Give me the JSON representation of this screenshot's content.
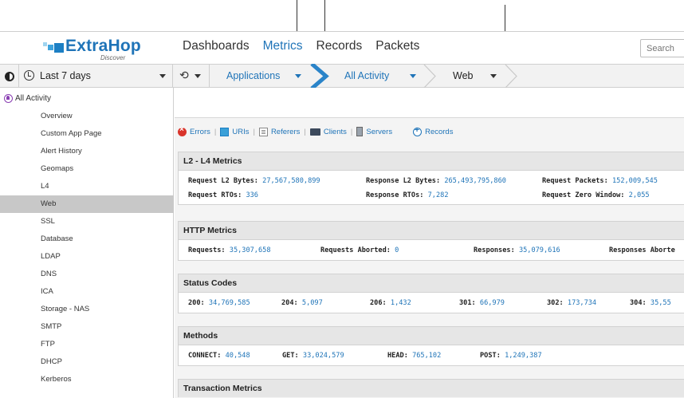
{
  "header": {
    "logo_text": "ExtraHop",
    "logo_sub": "Discover",
    "nav": [
      {
        "label": "Dashboards",
        "active": false
      },
      {
        "label": "Metrics",
        "active": true
      },
      {
        "label": "Records",
        "active": false
      },
      {
        "label": "Packets",
        "active": false
      }
    ],
    "search_placeholder": "Search"
  },
  "toolbar": {
    "time_range": "Last 7 days",
    "refresh_icon": "⟲",
    "breadcrumbs": [
      "Applications",
      "All Activity",
      "Web"
    ]
  },
  "sidebar": {
    "root": "All Activity",
    "items": [
      {
        "label": "Overview",
        "active": false
      },
      {
        "label": "Custom App Page",
        "active": false
      },
      {
        "label": "Alert History",
        "active": false
      },
      {
        "label": "Geomaps",
        "active": false
      },
      {
        "label": "L4",
        "active": false
      },
      {
        "label": "Web",
        "active": true
      },
      {
        "label": "SSL",
        "active": false
      },
      {
        "label": "Database",
        "active": false
      },
      {
        "label": "LDAP",
        "active": false
      },
      {
        "label": "DNS",
        "active": false
      },
      {
        "label": "ICA",
        "active": false
      },
      {
        "label": "Storage - NAS",
        "active": false
      },
      {
        "label": "SMTP",
        "active": false
      },
      {
        "label": "FTP",
        "active": false
      },
      {
        "label": "DHCP",
        "active": false
      },
      {
        "label": "Kerberos",
        "active": false
      }
    ]
  },
  "links": [
    {
      "label": "Errors",
      "icon": "error-icon"
    },
    {
      "label": "URIs",
      "icon": "uri-icon"
    },
    {
      "label": "Referers",
      "icon": "document-icon"
    },
    {
      "label": "Clients",
      "icon": "client-icon"
    },
    {
      "label": "Servers",
      "icon": "server-icon"
    },
    {
      "label": "Records",
      "icon": "add-record-icon"
    }
  ],
  "sections": {
    "l2l4": {
      "title": "L2 - L4 Metrics",
      "rows": [
        [
          {
            "k": "Request L2 Bytes:",
            "v": "27,567,580,899"
          },
          {
            "k": "Response L2 Bytes:",
            "v": "265,493,795,860"
          },
          {
            "k": "Request Packets:",
            "v": "152,009,545"
          }
        ],
        [
          {
            "k": "Request RTOs:",
            "v": "336"
          },
          {
            "k": "Response RTOs:",
            "v": "7,282"
          },
          {
            "k": "Request Zero Window:",
            "v": "2,055"
          }
        ]
      ]
    },
    "http": {
      "title": "HTTP Metrics",
      "items": [
        {
          "k": "Requests:",
          "v": "35,307,658"
        },
        {
          "k": "Requests Aborted:",
          "v": "0"
        },
        {
          "k": "Responses:",
          "v": "35,079,616"
        },
        {
          "k": "Responses Aborte",
          "v": ""
        }
      ]
    },
    "status": {
      "title": "Status Codes",
      "items": [
        {
          "k": "200:",
          "v": "34,769,585"
        },
        {
          "k": "204:",
          "v": "5,097"
        },
        {
          "k": "206:",
          "v": "1,432"
        },
        {
          "k": "301:",
          "v": "66,979"
        },
        {
          "k": "302:",
          "v": "173,734"
        },
        {
          "k": "304:",
          "v": "35,55"
        }
      ]
    },
    "methods": {
      "title": "Methods",
      "items": [
        {
          "k": "CONNECT:",
          "v": "40,548"
        },
        {
          "k": "GET:",
          "v": "33,024,579"
        },
        {
          "k": "HEAD:",
          "v": "765,102"
        },
        {
          "k": "POST:",
          "v": "1,249,387"
        }
      ]
    },
    "transaction": {
      "title": "Transaction Metrics"
    }
  },
  "colors": {
    "accent": "#1f74b8",
    "active_row": "#c8c8c8",
    "error": "#d9342b"
  }
}
